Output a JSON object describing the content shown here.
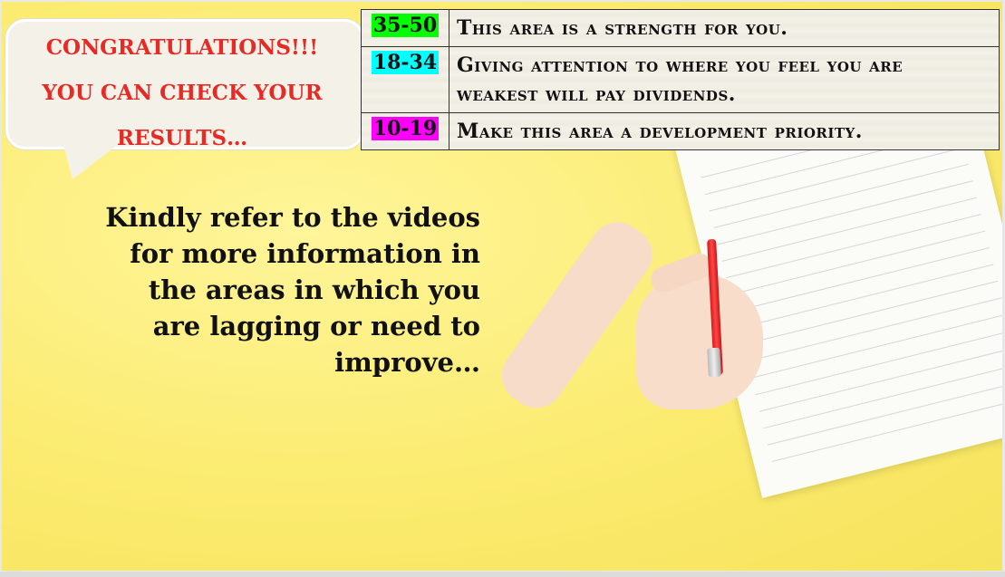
{
  "bubble": {
    "line1": "CONGRATULATIONS!!!",
    "line2": "YOU CAN CHECK YOUR",
    "line3": "RESULTS…"
  },
  "score_table": {
    "rows": [
      {
        "range": "35-50",
        "color": "#00ff00",
        "message": "This area is a strength for you."
      },
      {
        "range": "18-34",
        "color": "#00ffff",
        "message": "Giving attention to where you feel you are weakest will pay dividends."
      },
      {
        "range": "10-19",
        "color": "#ff00ff",
        "message": "Make this area a development priority."
      }
    ]
  },
  "info": {
    "text": "Kindly refer to the videos for more information in the areas in which you are lagging or need to improve…"
  },
  "colors": {
    "background": "#fbeb6f",
    "bubble_text": "#e62a25",
    "bubble_fill": "#f4f2e8"
  }
}
